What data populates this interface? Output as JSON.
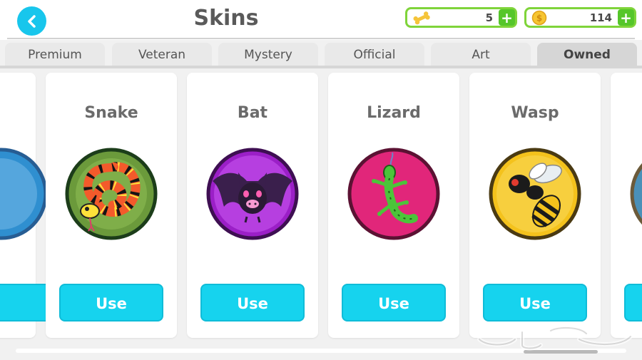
{
  "header": {
    "title": "Skins",
    "currencies": [
      {
        "icon": "bone-icon",
        "value": "5"
      },
      {
        "icon": "coin-icon",
        "value": "114"
      }
    ]
  },
  "tabs": [
    {
      "label": "Premium",
      "active": false
    },
    {
      "label": "Veteran",
      "active": false
    },
    {
      "label": "Mystery",
      "active": false
    },
    {
      "label": "Official",
      "active": false
    },
    {
      "label": "Art",
      "active": false
    },
    {
      "label": "Owned",
      "active": true
    }
  ],
  "cards": [
    {
      "name": "Snake",
      "button": "Use"
    },
    {
      "name": "Bat",
      "button": "Use"
    },
    {
      "name": "Lizard",
      "button": "Use"
    },
    {
      "name": "Wasp",
      "button": "Use"
    }
  ],
  "colors": {
    "accent": "#16d3ee",
    "currency_border": "#7fd43a",
    "plus_button": "#55c62a"
  }
}
